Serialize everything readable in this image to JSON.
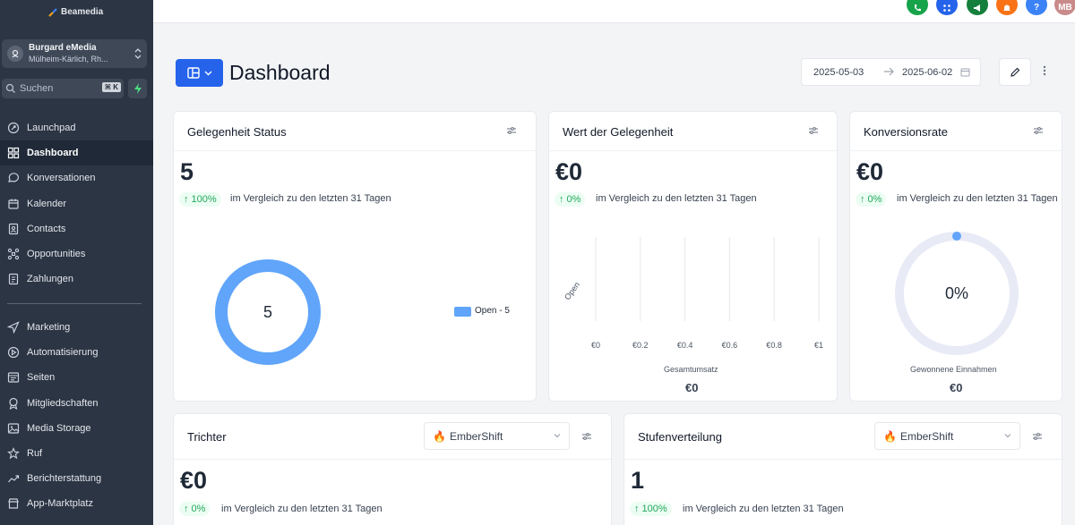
{
  "app": {
    "brand": "Beamedia",
    "account_name": "Burgard eMedia",
    "account_location": "Mülheim-Kärlich, Rh...",
    "search_placeholder": "Suchen",
    "search_shortcut": "⌘ K"
  },
  "sidebar": {
    "items": [
      {
        "label": "Launchpad",
        "icon": "rocket-icon"
      },
      {
        "label": "Dashboard",
        "icon": "grid-icon",
        "active": true
      },
      {
        "label": "Konversationen",
        "icon": "chat-icon"
      },
      {
        "label": "Kalender",
        "icon": "calendar-icon"
      },
      {
        "label": "Contacts",
        "icon": "contacts-icon"
      },
      {
        "label": "Opportunities",
        "icon": "opportunities-icon"
      },
      {
        "label": "Zahlungen",
        "icon": "payments-icon"
      }
    ],
    "items2": [
      {
        "label": "Marketing",
        "icon": "send-icon"
      },
      {
        "label": "Automatisierung",
        "icon": "automation-icon"
      },
      {
        "label": "Seiten",
        "icon": "pages-icon"
      },
      {
        "label": "Mitgliedschaften",
        "icon": "membership-icon"
      },
      {
        "label": "Media Storage",
        "icon": "media-icon"
      },
      {
        "label": "Ruf",
        "icon": "star-icon"
      },
      {
        "label": "Berichterstattung",
        "icon": "report-icon"
      },
      {
        "label": "App-Marktplatz",
        "icon": "marketplace-icon"
      }
    ]
  },
  "topbar": {
    "icons": [
      {
        "name": "phone-icon",
        "color": "#16a34a"
      },
      {
        "name": "apps-icon",
        "color": "#2563eb"
      },
      {
        "name": "megaphone-icon",
        "color": "#15803d"
      },
      {
        "name": "bell-icon",
        "color": "#f97316"
      },
      {
        "name": "help-icon",
        "color": "#3b82f6",
        "glyph": "?"
      },
      {
        "name": "avatar",
        "color": "#c98a8a",
        "glyph": "MB"
      }
    ]
  },
  "header": {
    "title": "Dashboard",
    "date_from": "2025-05-03",
    "date_to": "2025-06-02"
  },
  "cards": {
    "status": {
      "title": "Gelegenheit Status",
      "value": "5",
      "badge": "↑ 100%",
      "compare": "im Vergleich zu den letzten 31 Tagen",
      "donut_center": "5",
      "legend": "Open - 5",
      "color": "#60a5fa"
    },
    "value": {
      "title": "Wert der Gelegenheit",
      "value": "€0",
      "badge": "↑ 0%",
      "compare": "im Vergleich zu den letzten 31 Tagen",
      "y_category": "Open",
      "x_ticks": [
        "€0",
        "€0.2",
        "€0.4",
        "€0.6",
        "€0.8",
        "€1"
      ],
      "x_label": "Gesamtumsatz",
      "total": "€0"
    },
    "conversion": {
      "title": "Konversionsrate",
      "value": "€0",
      "badge": "↑ 0%",
      "compare": "im Vergleich zu den letzten 31 Tagen",
      "gauge_value": "0%",
      "gauge_label": "Gewonnene Einnahmen",
      "total": "€0"
    },
    "funnel": {
      "title": "Trichter",
      "dropdown": "EmberShift",
      "value": "€0",
      "badge": "↑ 0%",
      "compare": "im Vergleich zu den letzten 31 Tagen"
    },
    "stages": {
      "title": "Stufenverteilung",
      "dropdown": "EmberShift",
      "value": "1",
      "badge": "↑ 100%",
      "compare": "im Vergleich zu den letzten 31 Tagen"
    }
  }
}
